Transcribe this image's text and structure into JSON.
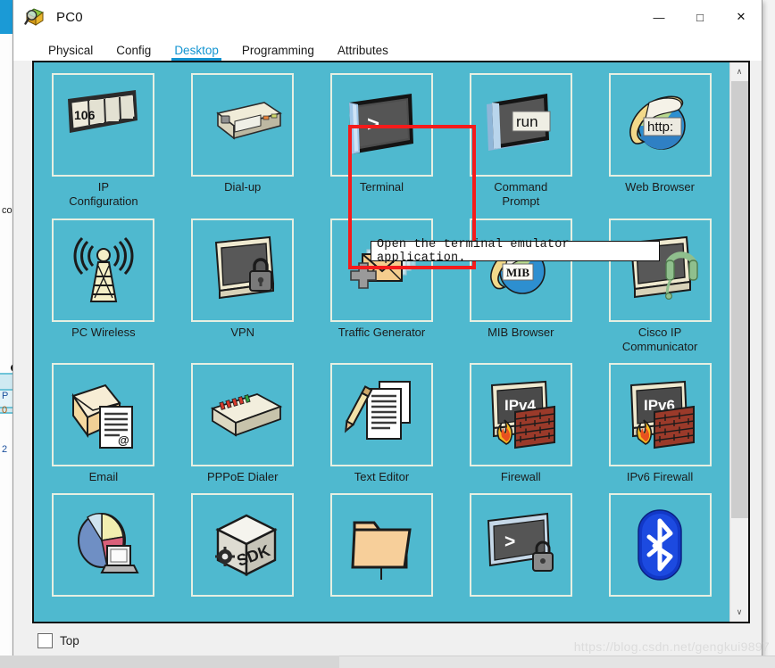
{
  "window": {
    "title": "PC0",
    "icon": "packet-tracer-icon",
    "controls": {
      "minimize": "—",
      "maximize": "□",
      "close": "✕"
    }
  },
  "tabs": [
    {
      "label": "Physical",
      "active": false
    },
    {
      "label": "Config",
      "active": false
    },
    {
      "label": "Desktop",
      "active": true
    },
    {
      "label": "Programming",
      "active": false
    },
    {
      "label": "Attributes",
      "active": false
    }
  ],
  "desktop": {
    "background_color": "#4fb9cf",
    "rows": [
      [
        {
          "label": "IP\nConfiguration",
          "icon": "ip-configuration-icon",
          "icon_text": "106"
        },
        {
          "label": "Dial-up",
          "icon": "dial-up-modem-icon"
        },
        {
          "label": "Terminal",
          "icon": "terminal-icon",
          "icon_text": ">",
          "highlighted": true
        },
        {
          "label": "Command\nPrompt",
          "icon": "command-prompt-icon",
          "icon_text": "run"
        },
        {
          "label": "Web Browser",
          "icon": "web-browser-icon",
          "icon_text": "http:"
        }
      ],
      [
        {
          "label": "PC Wireless",
          "icon": "pc-wireless-icon"
        },
        {
          "label": "VPN",
          "icon": "vpn-icon"
        },
        {
          "label": "Traffic Generator",
          "icon": "traffic-generator-icon"
        },
        {
          "label": "MIB Browser",
          "icon": "mib-browser-icon",
          "icon_text": "MIB"
        },
        {
          "label": "Cisco IP Communicator",
          "icon": "cisco-ip-communicator-icon"
        }
      ],
      [
        {
          "label": "Email",
          "icon": "email-icon"
        },
        {
          "label": "PPPoE Dialer",
          "icon": "pppoe-dialer-icon"
        },
        {
          "label": "Text Editor",
          "icon": "text-editor-icon"
        },
        {
          "label": "Firewall",
          "icon": "firewall-icon",
          "icon_text": "IPv4"
        },
        {
          "label": "IPv6 Firewall",
          "icon": "ipv6-firewall-icon",
          "icon_text": "IPv6"
        }
      ],
      [
        {
          "label": "",
          "icon": "chart-monitor-icon"
        },
        {
          "label": "",
          "icon": "sdk-box-icon",
          "icon_text": "SDK"
        },
        {
          "label": "",
          "icon": "folder-icon"
        },
        {
          "label": "",
          "icon": "secure-terminal-icon",
          "icon_text": ">"
        },
        {
          "label": "",
          "icon": "bluetooth-icon"
        }
      ]
    ]
  },
  "tooltip": {
    "text": "Open the terminal emulator application.",
    "target": "Terminal"
  },
  "annotation": {
    "type": "red-rectangle",
    "color": "#f51b1b",
    "target": "Terminal"
  },
  "footer": {
    "checkbox_label": "Top",
    "checkbox_checked": false
  },
  "scrollbar": {
    "up_arrow": "∧",
    "down_arrow": "∨"
  },
  "watermark": {
    "text": "https://blog.csdn.net/gengkui9897"
  },
  "background_window": {
    "fragments": [
      "co",
      "P",
      "0",
      "2"
    ]
  }
}
